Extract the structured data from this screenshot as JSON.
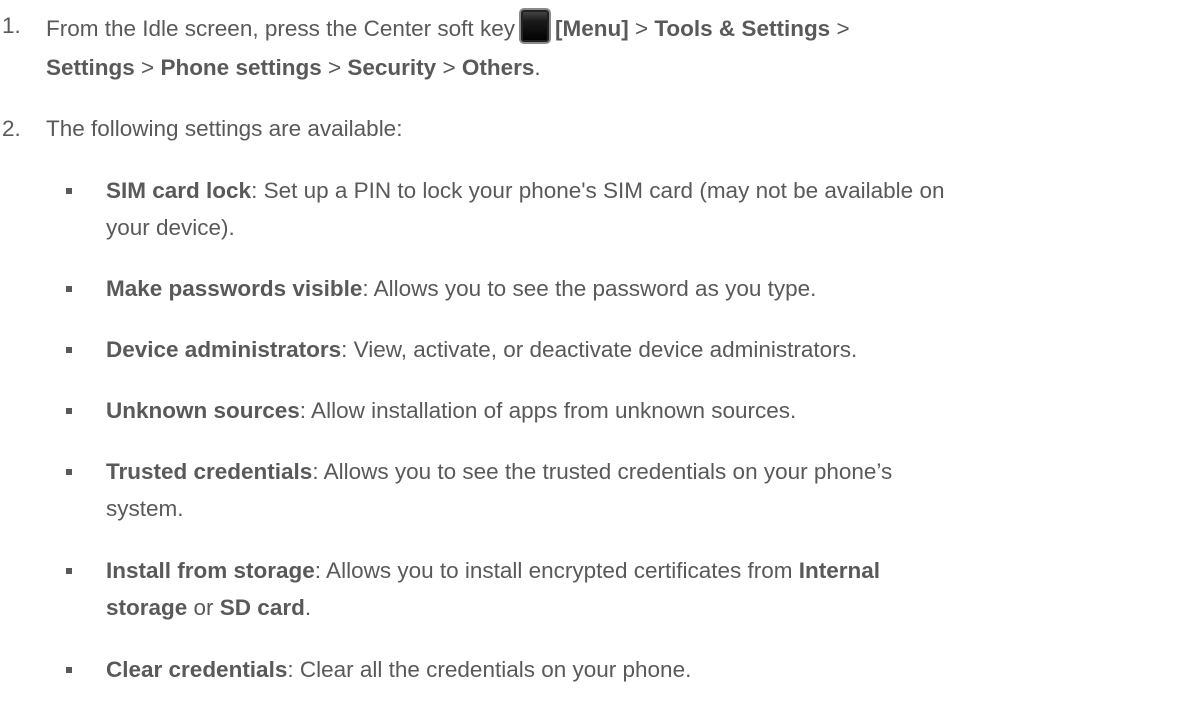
{
  "step1": {
    "num": "1.",
    "text_a": "From the Idle screen, press the Center soft key",
    "icon": "center-soft-key-icon",
    "menu": "[Menu]",
    "sep1": ">",
    "tools": "Tools & Settings",
    "sep2": ">",
    "settings": "Settings",
    "sep3": ">",
    "phone_settings": "Phone settings",
    "sep4": ">",
    "security": "Security",
    "sep5": ">",
    "others": "Others",
    "end": "."
  },
  "step2": {
    "num": "2.",
    "text": "The following settings are available:"
  },
  "items": [
    {
      "title": "SIM card lock",
      "line1": ": Set up a PIN to lock your phone's SIM card (may not be available on",
      "line2": "your device)."
    },
    {
      "title": "Make passwords visible",
      "line1": ": Allows you to see the password as you type."
    },
    {
      "title": "Device administrators",
      "line1": ": View, activate, or deactivate device administrators."
    },
    {
      "title": "Unknown sources",
      "line1": ": Allow installation of apps from unknown sources."
    },
    {
      "title": "Trusted credentials",
      "line1": ": Allows you to see the trusted credentials on your phone’s",
      "line2": "system."
    },
    {
      "title": "Install from storage",
      "line1": ": Allows you to install encrypted certificates from ",
      "bold1": "Internal",
      "bold2": "storage",
      "mid": " or ",
      "bold3": "SD card",
      "end": "."
    },
    {
      "title": "Clear credentials",
      "line1": ": Clear all the credentials on your phone."
    }
  ]
}
